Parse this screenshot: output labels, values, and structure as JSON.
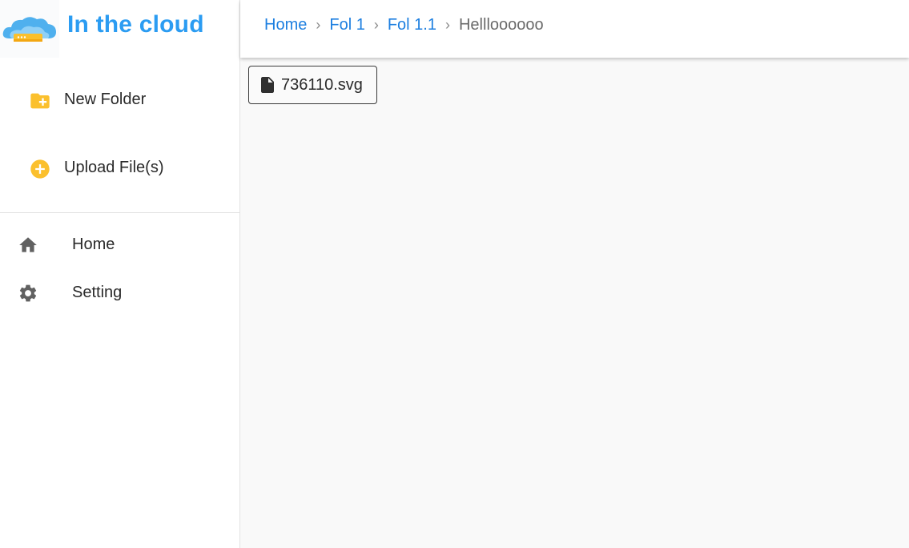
{
  "brand": {
    "title": "In the cloud",
    "logo_icon": "cloud-server-icon"
  },
  "sidebar": {
    "actions": [
      {
        "label": "New Folder",
        "icon": "create-new-folder-icon",
        "color": "#fbc02d"
      },
      {
        "label": "Upload File(s)",
        "icon": "add-circle-icon",
        "color": "#fbc02d"
      }
    ],
    "nav": [
      {
        "label": "Home",
        "icon": "home-icon"
      },
      {
        "label": "Setting",
        "icon": "gear-icon"
      }
    ]
  },
  "breadcrumb": {
    "items": [
      "Home",
      "Fol 1",
      "Fol 1.1"
    ],
    "current": "Hellloooooo",
    "separator": "›"
  },
  "files": [
    {
      "name": "736110.svg",
      "icon": "file-icon"
    }
  ],
  "colors": {
    "brand": "#2b9cf2",
    "link": "#1d7fe0",
    "accent": "#fbc02d",
    "icon_gray": "#616161"
  }
}
